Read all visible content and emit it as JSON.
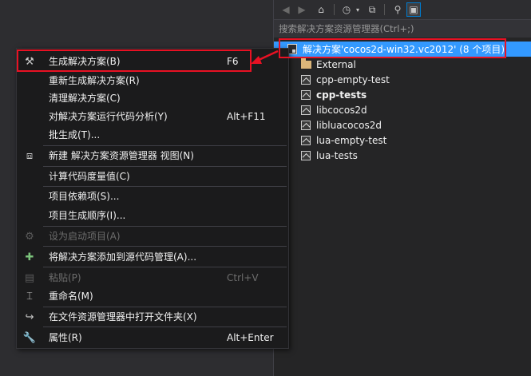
{
  "toolbar": {
    "icons": [
      "back-icon",
      "forward-icon",
      "home-icon",
      "history-icon",
      "dropdown-icon",
      "collapse-all-icon",
      "properties-icon",
      "show-all-files-icon"
    ]
  },
  "solution_explorer": {
    "search_placeholder": "搜索解决方案资源管理器(Ctrl+;)",
    "solution_label": "解决方案'cocos2d-win32.vc2012' (8 个项目)",
    "items": [
      {
        "label": "External",
        "type": "folder"
      },
      {
        "label": "cpp-empty-test",
        "type": "project"
      },
      {
        "label": "cpp-tests",
        "type": "project",
        "bold": true
      },
      {
        "label": "libcocos2d",
        "type": "project"
      },
      {
        "label": "libluacocos2d",
        "type": "project"
      },
      {
        "label": "lua-empty-test",
        "type": "project"
      },
      {
        "label": "lua-tests",
        "type": "project"
      }
    ]
  },
  "context_menu": {
    "items": [
      {
        "label": "生成解决方案(B)",
        "shortcut": "F6",
        "icon": "build-icon",
        "enabled": true
      },
      {
        "label": "重新生成解决方案(R)",
        "shortcut": "",
        "icon": "",
        "enabled": true
      },
      {
        "label": "清理解决方案(C)",
        "shortcut": "",
        "icon": "",
        "enabled": true
      },
      {
        "label": "对解决方案运行代码分析(Y)",
        "shortcut": "Alt+F11",
        "icon": "",
        "enabled": true
      },
      {
        "label": "批生成(T)...",
        "shortcut": "",
        "icon": "",
        "enabled": true
      },
      {
        "label": "新建 解决方案资源管理器 视图(N)",
        "shortcut": "",
        "icon": "new-view-icon",
        "enabled": true
      },
      {
        "label": "计算代码度量值(C)",
        "shortcut": "",
        "icon": "",
        "enabled": true
      },
      {
        "label": "项目依赖项(S)...",
        "shortcut": "",
        "icon": "",
        "enabled": true
      },
      {
        "label": "项目生成顺序(I)...",
        "shortcut": "",
        "icon": "",
        "enabled": true
      },
      {
        "label": "设为启动项目(A)",
        "shortcut": "",
        "icon": "gear-icon",
        "enabled": false
      },
      {
        "label": "将解决方案添加到源代码管理(A)...",
        "shortcut": "",
        "icon": "source-control-icon",
        "enabled": true
      },
      {
        "label": "粘贴(P)",
        "shortcut": "Ctrl+V",
        "icon": "paste-icon",
        "enabled": false
      },
      {
        "label": "重命名(M)",
        "shortcut": "",
        "icon": "rename-icon",
        "enabled": true
      },
      {
        "label": "在文件资源管理器中打开文件夹(X)",
        "shortcut": "",
        "icon": "open-folder-icon",
        "enabled": true
      },
      {
        "label": "属性(R)",
        "shortcut": "Alt+Enter",
        "icon": "wrench-icon",
        "enabled": true
      }
    ]
  },
  "colors": {
    "accent": "#3399ff",
    "highlight_box": "#e81123",
    "menu_bg": "#1b1b1c",
    "panel_bg": "#252526"
  }
}
